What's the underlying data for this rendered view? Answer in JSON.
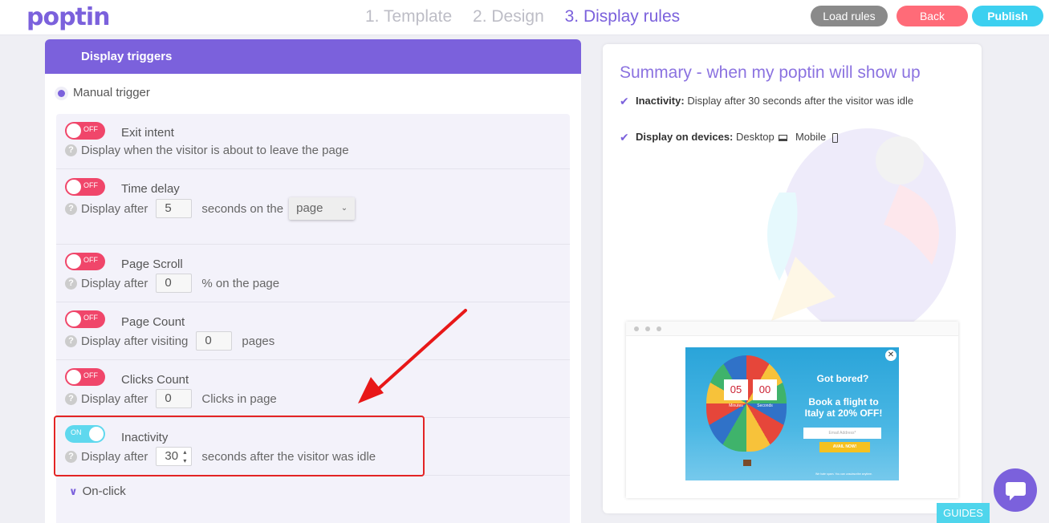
{
  "header": {
    "logo": "poptin",
    "steps": [
      "1. Template",
      "2. Design",
      "3. Display rules"
    ],
    "active_step": 2,
    "load_rules_label": "Load rules",
    "back_label": "Back",
    "publish_label": "Publish"
  },
  "left": {
    "header": "Display triggers",
    "manual_trigger": "Manual trigger",
    "triggers": {
      "exit": {
        "toggle": "OFF",
        "title": "Exit intent",
        "desc": "Display when the visitor is about to leave the page"
      },
      "time": {
        "toggle": "OFF",
        "title": "Time delay",
        "desc_pre": "Display after",
        "value": "5",
        "desc_post": "seconds on the",
        "select": "page"
      },
      "scroll": {
        "toggle": "OFF",
        "title": "Page Scroll",
        "desc_pre": "Display after",
        "value": "0",
        "desc_post": "% on the page"
      },
      "count": {
        "toggle": "OFF",
        "title": "Page Count",
        "desc_pre": "Display after visiting",
        "value": "0",
        "desc_post": "pages"
      },
      "clicks": {
        "toggle": "OFF",
        "title": "Clicks Count",
        "desc_pre": "Display after",
        "value": "0",
        "desc_post": "Clicks in page"
      },
      "inactivity": {
        "toggle": "ON",
        "title": "Inactivity",
        "desc_pre": "Display after",
        "value": "30",
        "desc_post": "seconds after the visitor was idle"
      }
    },
    "onclick": "On-click"
  },
  "summary": {
    "title": "Summary - when my poptin will show up",
    "inactivity_label": "Inactivity:",
    "inactivity_text": "Display after 30 seconds after the visitor was idle",
    "devices_label": "Display on devices:",
    "device_desktop": "Desktop",
    "device_mobile": "Mobile"
  },
  "preview": {
    "minutes": "05",
    "seconds": "00",
    "minutes_label": "Minutes",
    "seconds_label": "Seconds",
    "title": "Got bored?",
    "text": "Book a flight to Italy at 20% OFF!",
    "email_placeholder": "Email Address*",
    "button": "AVAIL NOW!",
    "footer": "We hate spam. You can unsubscribe anytime."
  },
  "guides_label": "GUIDES",
  "colors": {
    "brand": "#7b61dc",
    "off": "#f0466a",
    "on": "#5fd8ee",
    "highlight": "#e32424"
  }
}
